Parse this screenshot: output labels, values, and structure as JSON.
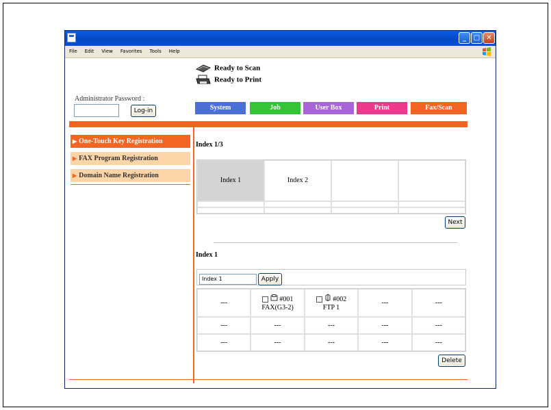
{
  "menu": [
    "File",
    "Edit",
    "View",
    "Favorites",
    "Tools",
    "Help"
  ],
  "status": {
    "scan": "Ready to Scan",
    "print": "Ready to Print"
  },
  "admin": {
    "password_label": "Administrator Password :",
    "login_label": "Log-in"
  },
  "tabs": [
    {
      "label": "System",
      "color": "#4b6fd6"
    },
    {
      "label": "Job",
      "color": "#35c435"
    },
    {
      "label": "User Box",
      "color": "#a765d8"
    },
    {
      "label": "Print",
      "color": "#ec3b8c"
    },
    {
      "label": "Fax/Scan",
      "color": "#f26522"
    }
  ],
  "sidebar": {
    "items": [
      {
        "label": "One-Touch Key Registration"
      },
      {
        "label": "FAX Program Registration"
      },
      {
        "label": "Domain Name Registration"
      }
    ]
  },
  "index_section": {
    "heading": "Index 1/3",
    "cells": [
      [
        "Index 1",
        "Index 2",
        "",
        ""
      ],
      [
        "",
        "",
        "",
        ""
      ],
      [
        "",
        "",
        "",
        ""
      ]
    ],
    "next_label": "Next"
  },
  "entry_section": {
    "heading": "Index 1",
    "index_value": "Index 1",
    "apply_label": "Apply",
    "rows": [
      [
        {
          "text": "---"
        },
        {
          "number": "#001",
          "name": "FAX(G3-2)",
          "icon": "fax-icon"
        },
        {
          "number": "#002",
          "name": "FTP 1",
          "icon": "ftp-icon"
        },
        {
          "text": "---"
        },
        {
          "text": "---"
        }
      ],
      [
        {
          "text": "---"
        },
        {
          "text": "---"
        },
        {
          "text": "---"
        },
        {
          "text": "---"
        },
        {
          "text": "---"
        }
      ],
      [
        {
          "text": "---"
        },
        {
          "text": "---"
        },
        {
          "text": "---"
        },
        {
          "text": "---"
        },
        {
          "text": "---"
        }
      ]
    ],
    "delete_label": "Delete"
  },
  "colors": {
    "accent": "#f26522",
    "side_inactive": "#fdd5a8",
    "titlebar": "#0a5ee4"
  }
}
